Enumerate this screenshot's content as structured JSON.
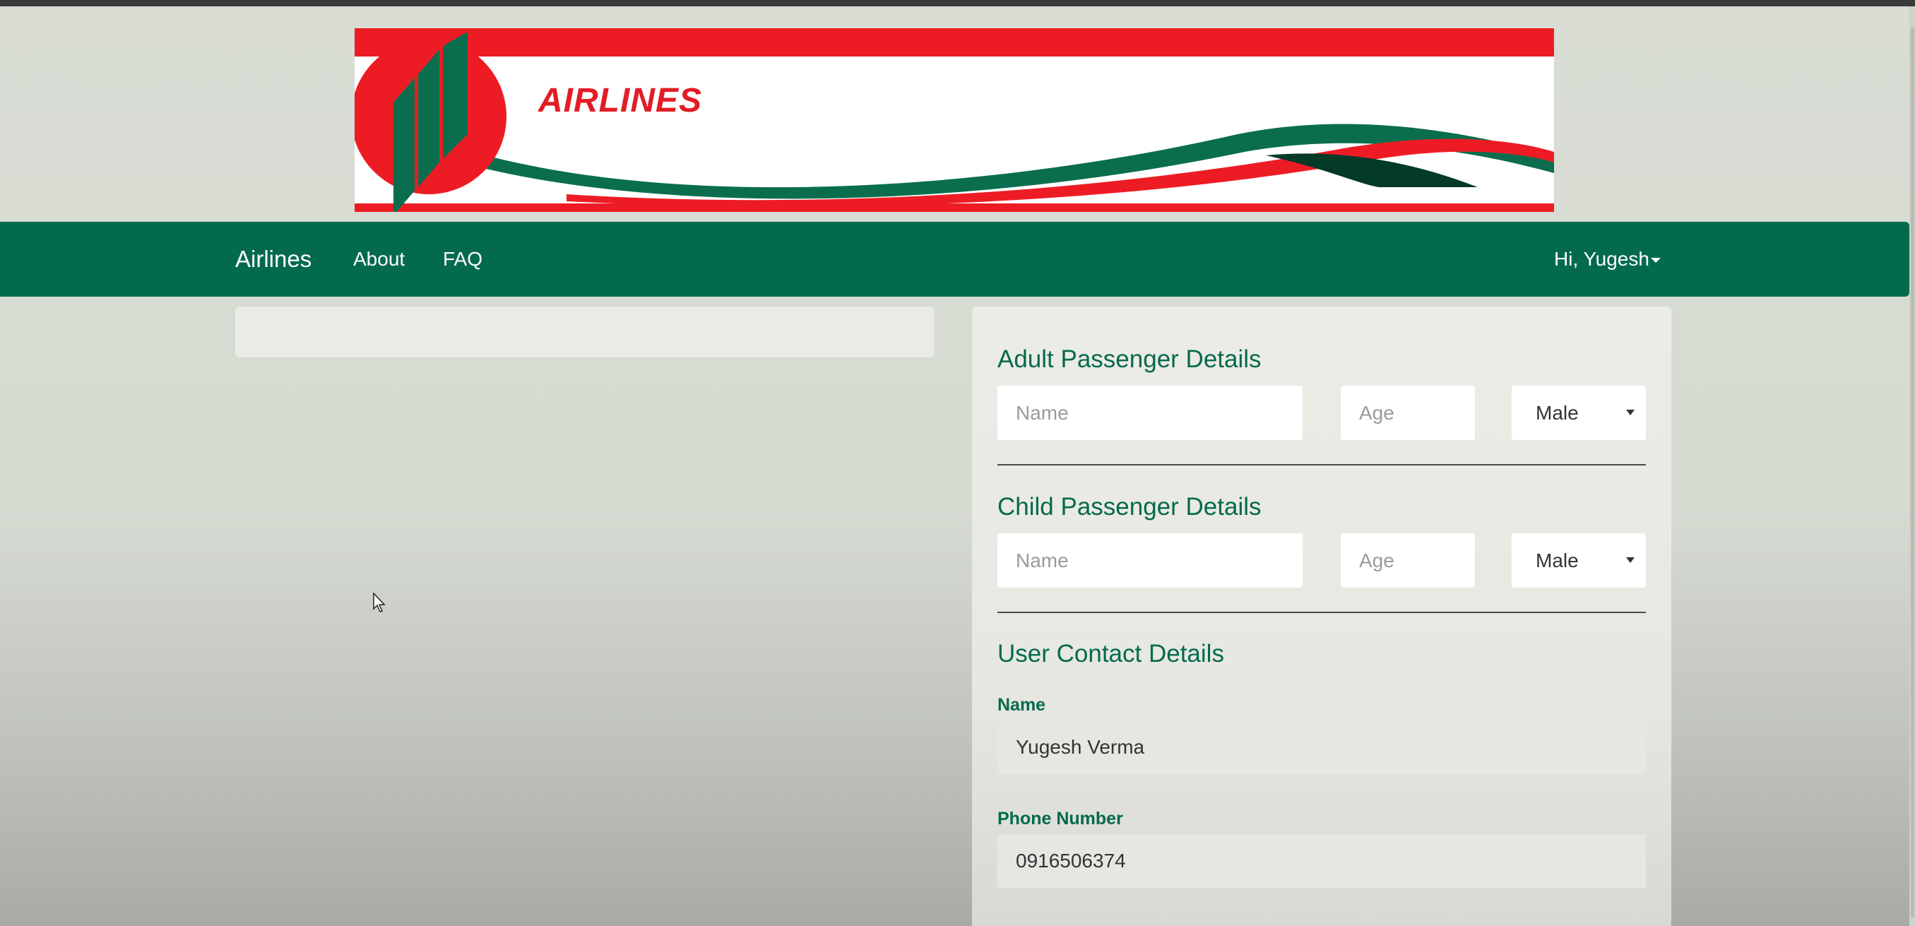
{
  "banner": {
    "logo_text": "AIRLINES"
  },
  "navbar": {
    "brand": "Airlines",
    "links": [
      "About",
      "FAQ"
    ],
    "user_greeting": "Hi, Yugesh"
  },
  "adult_section": {
    "title": "Adult Passenger Details",
    "name_placeholder": "Name",
    "age_placeholder": "Age",
    "gender_selected": "Male"
  },
  "child_section": {
    "title": "Child Passenger Details",
    "name_placeholder": "Name",
    "age_placeholder": "Age",
    "gender_selected": "Male"
  },
  "contact_section": {
    "title": "User Contact Details",
    "name_label": "Name",
    "name_value": "Yugesh Verma",
    "phone_label": "Phone Number",
    "phone_value": "0916506374"
  },
  "colors": {
    "brand_green": "#046a4d",
    "brand_red": "#e11d26"
  }
}
